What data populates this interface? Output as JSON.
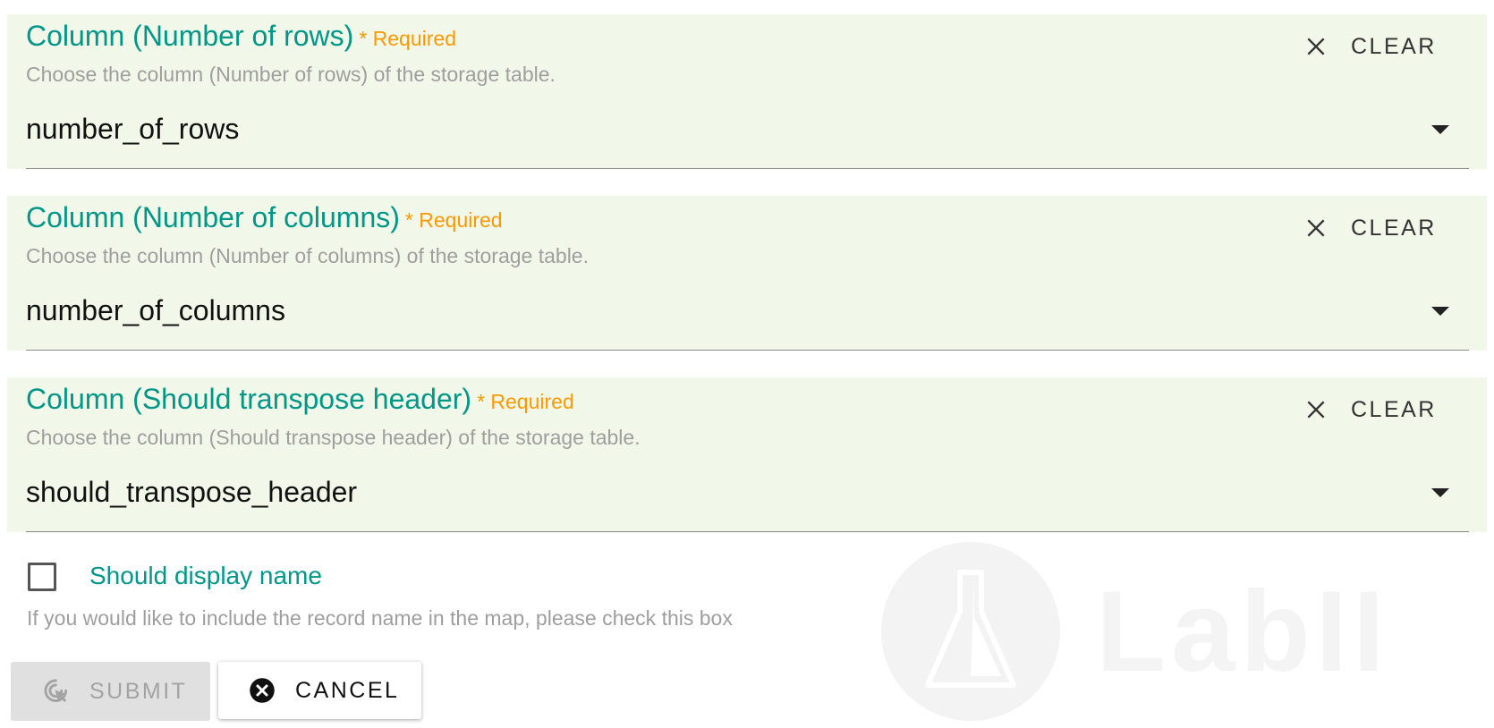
{
  "fields": [
    {
      "title": "Column (Number of rows)",
      "required": "* Required",
      "description": "Choose the column (Number of rows) of the storage table.",
      "value": "number_of_rows",
      "clear_label": "CLEAR"
    },
    {
      "title": "Column (Number of columns)",
      "required": "* Required",
      "description": "Choose the column (Number of columns) of the storage table.",
      "value": "number_of_columns",
      "clear_label": "CLEAR"
    },
    {
      "title": "Column (Should transpose header)",
      "required": "* Required",
      "description": "Choose the column (Should transpose header) of the storage table.",
      "value": "should_transpose_header",
      "clear_label": "CLEAR"
    }
  ],
  "checkbox": {
    "label": "Should display name",
    "help": "If you would like to include the record name in the map, please check this box",
    "checked": false
  },
  "actions": {
    "submit_label": "SUBMIT",
    "cancel_label": "CANCEL"
  },
  "watermark": {
    "text": "LabII",
    "logo": "flask-logo"
  },
  "colors": {
    "field_background": "#f1f8e9",
    "label_teal": "#009688",
    "required_orange": "#ff9800",
    "help_gray": "#9e9e9e",
    "submit_disabled_bg": "#e0e0e0"
  },
  "icons": {
    "clear": "close-icon",
    "dropdown": "caret-down-icon",
    "submit": "cursor-click-icon",
    "cancel": "cancel-circle-icon"
  }
}
